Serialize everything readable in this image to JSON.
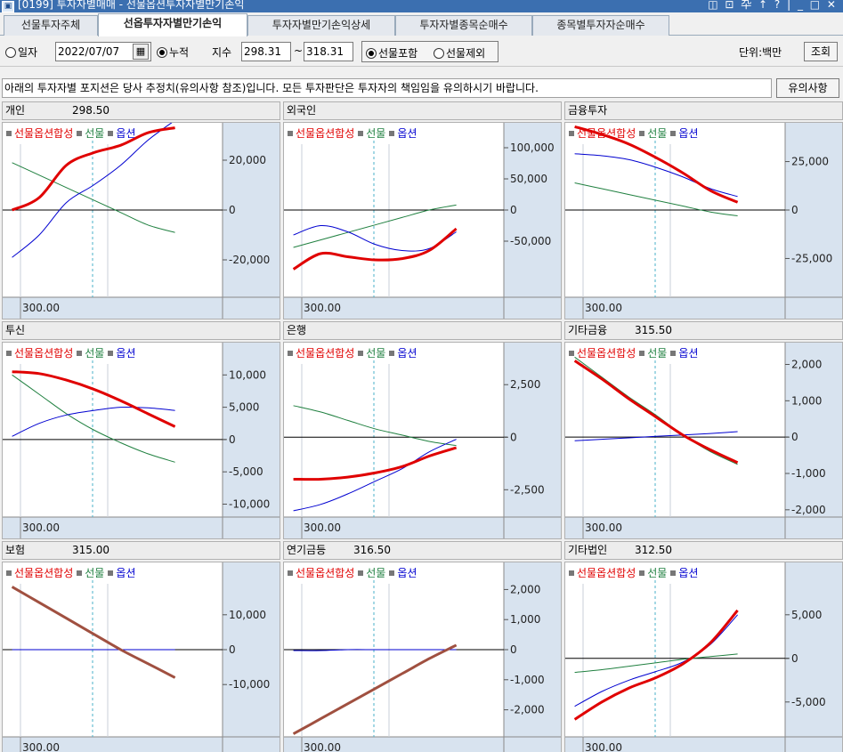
{
  "window": {
    "title": "[0199] 투자자별매매 - 선물옵션투자자별만기손익",
    "controls": "◫ ⊡ 卆 ↑ ? | _ □ ✕"
  },
  "tabs": [
    {
      "label": "선물투자주체",
      "active": false
    },
    {
      "label": "선옵투자자별만기손익",
      "active": true
    },
    {
      "label": "투자자별만기손익상세",
      "active": false
    },
    {
      "label": "투자자별종목순매수",
      "active": false
    },
    {
      "label": "종목별투자자순매수",
      "active": false
    }
  ],
  "toolbar": {
    "radio_date": "일자",
    "date_value": "2022/07/07",
    "radio_cumulative": "누적",
    "index_label": "지수",
    "index_from": "298.31",
    "index_tilde": "~",
    "index_to": "318.31",
    "radio_include": "선물포함",
    "radio_exclude": "선물제외",
    "unit_label": "단위:백만",
    "query_button": "조회"
  },
  "notice": {
    "text": "아래의 투자자별 포지션은 당사 추정치(유의사항 참조)입니다. 모든 투자판단은 투자자의 책임임을 유의하시기 바랍니다.",
    "button": "유의사항"
  },
  "legend": {
    "sum": "선물옵션합성",
    "futures": "선물",
    "options": "옵션"
  },
  "colors": {
    "sum": "#e00000",
    "futures": "#208040",
    "options": "#0000d0",
    "brand": "#3b6fb0"
  },
  "chart_data": [
    {
      "name": "개인",
      "price": "298.50",
      "ymin": -35000,
      "ymax": 35000,
      "yticks": [
        "20,000",
        "0",
        "-20,000"
      ],
      "xtick": "300.00",
      "x": [
        296,
        300,
        304,
        308,
        312,
        316,
        320
      ],
      "sum": [
        0,
        5000,
        18000,
        23000,
        26000,
        31000,
        33000
      ],
      "futures": [
        19000,
        14000,
        9000,
        4000,
        -1000,
        -6000,
        -9000
      ],
      "options": [
        -19000,
        -10000,
        3000,
        10000,
        18000,
        28000,
        36000
      ]
    },
    {
      "name": "외국인",
      "price": "",
      "ymin": -140000,
      "ymax": 140000,
      "yticks": [
        "100,000",
        "50,000",
        "0",
        "-50,000"
      ],
      "xtick": "300.00",
      "x": [
        296,
        300,
        304,
        308,
        312,
        316,
        320
      ],
      "sum": [
        -95000,
        -70000,
        -75000,
        -80000,
        -78000,
        -65000,
        -30000
      ],
      "futures": [
        -60000,
        -48000,
        -36000,
        -24000,
        -12000,
        0,
        8000
      ],
      "options": [
        -40000,
        -25000,
        -35000,
        -55000,
        -65000,
        -62000,
        -35000
      ]
    },
    {
      "name": "금융투자",
      "price": "",
      "ymin": -45000,
      "ymax": 45000,
      "yticks": [
        "25,000",
        "0",
        "-25,000"
      ],
      "xtick": "300.00",
      "x": [
        296,
        300,
        304,
        308,
        312,
        316,
        320
      ],
      "sum": [
        43000,
        39000,
        34000,
        27000,
        19000,
        10000,
        4000
      ],
      "futures": [
        14000,
        11000,
        8000,
        5000,
        2000,
        -1000,
        -3000
      ],
      "options": [
        29000,
        28000,
        26000,
        22000,
        17000,
        11000,
        7000
      ]
    },
    {
      "name": "투신",
      "price": "",
      "ymin": -12000,
      "ymax": 15000,
      "yticks": [
        "10,000",
        "5,000",
        "0",
        "-5,000",
        "-10,000"
      ],
      "xtick": "300.00",
      "x": [
        296,
        300,
        304,
        308,
        312,
        316,
        320
      ],
      "sum": [
        10500,
        10200,
        9200,
        7800,
        6000,
        4000,
        2000
      ],
      "futures": [
        10000,
        7000,
        4000,
        1500,
        -500,
        -2200,
        -3500
      ],
      "options": [
        500,
        2500,
        3800,
        4500,
        5000,
        4900,
        4500
      ]
    },
    {
      "name": "은행",
      "price": "",
      "ymin": -3800,
      "ymax": 4500,
      "yticks": [
        "2,500",
        "0",
        "-2,500"
      ],
      "xtick": "300.00",
      "x": [
        296,
        300,
        304,
        308,
        312,
        316,
        320
      ],
      "sum": [
        -2000,
        -2000,
        -1900,
        -1700,
        -1400,
        -900,
        -500
      ],
      "futures": [
        1500,
        1200,
        800,
        400,
        100,
        -200,
        -400
      ],
      "options": [
        -3500,
        -3200,
        -2700,
        -2100,
        -1500,
        -700,
        -100
      ]
    },
    {
      "name": "기타금융",
      "price": "315.50",
      "ymin": -2200,
      "ymax": 2600,
      "yticks": [
        "2,000",
        "1,000",
        "0",
        "-1,000",
        "-2,000"
      ],
      "xtick": "300.00",
      "x": [
        296,
        300,
        304,
        308,
        312,
        316,
        320
      ],
      "sum": [
        2100,
        1600,
        1050,
        550,
        50,
        -350,
        -700
      ],
      "futures": [
        2200,
        1650,
        1100,
        600,
        50,
        -400,
        -750
      ],
      "options": [
        -100,
        -60,
        -20,
        20,
        60,
        100,
        150
      ]
    },
    {
      "name": "보험",
      "price": "315.00",
      "ymin": -25000,
      "ymax": 25000,
      "yticks": [
        "10,000",
        "0",
        "-10,000"
      ],
      "xtick": "300.00",
      "x": [
        296,
        300,
        304,
        308,
        312,
        316,
        320
      ],
      "sum": [
        18000,
        13500,
        9000,
        4500,
        0,
        -4000,
        -8000
      ],
      "futures": [
        18000,
        13500,
        9000,
        4500,
        0,
        -4000,
        -8000
      ],
      "options": [
        0,
        0,
        0,
        0,
        0,
        0,
        0
      ]
    },
    {
      "name": "연기금등",
      "price": "316.50",
      "ymin": -2900,
      "ymax": 2900,
      "yticks": [
        "2,000",
        "1,000",
        "0",
        "-1,000",
        "-2,000"
      ],
      "xtick": "300.00",
      "x": [
        296,
        300,
        304,
        308,
        312,
        316,
        320
      ],
      "sum": [
        -2800,
        -2300,
        -1800,
        -1300,
        -800,
        -300,
        150
      ],
      "futures": [
        -2800,
        -2300,
        -1800,
        -1300,
        -800,
        -300,
        150
      ],
      "options": [
        -30,
        -30,
        0,
        0,
        0,
        0,
        0
      ]
    },
    {
      "name": "기타법인",
      "price": "312.50",
      "ymin": -9000,
      "ymax": 11000,
      "yticks": [
        "5,000",
        "0",
        "-5,000"
      ],
      "xtick": "300.00",
      "x": [
        296,
        300,
        304,
        308,
        312,
        316,
        320
      ],
      "sum": [
        -7000,
        -5000,
        -3400,
        -2200,
        -600,
        1800,
        5500
      ],
      "futures": [
        -1600,
        -1300,
        -900,
        -500,
        -100,
        200,
        500
      ],
      "options": [
        -5500,
        -3800,
        -2500,
        -1500,
        -400,
        1600,
        5000
      ]
    }
  ]
}
